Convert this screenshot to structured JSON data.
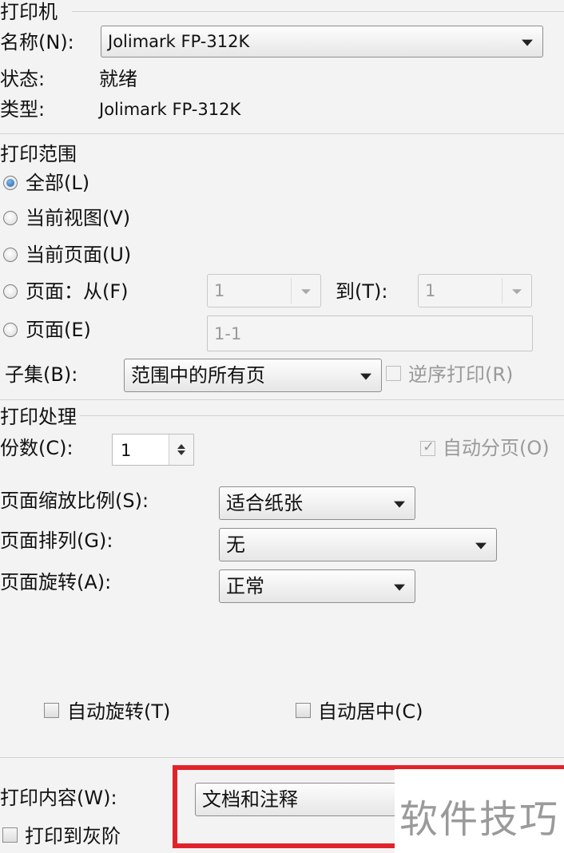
{
  "printer": {
    "group_title": "打印机",
    "name_label": "名称(N):",
    "name_value": "Jolimark FP-312K",
    "status_label": "状态:",
    "status_value": "就绪",
    "type_label": "类型:",
    "type_value": "Jolimark FP-312K"
  },
  "range": {
    "group_title": "打印范围",
    "all_label": "全部(L)",
    "current_view_label": "当前视图(V)",
    "current_page_label": "当前页面(U)",
    "pages_from_label": "页面：从(F)",
    "from_value": "1",
    "to_label": "到(T):",
    "to_value": "1",
    "pages_label": "页面(E)",
    "pages_value": "1-1",
    "subset_label": "子集(B):",
    "subset_value": "范围中的所有页",
    "reverse_label": "逆序打印(R)"
  },
  "handling": {
    "group_title": "打印处理",
    "copies_label": "份数(C):",
    "copies_value": "1",
    "collate_label": "自动分页(O)",
    "scale_label": "页面缩放比例(S):",
    "scale_value": "适合纸张",
    "arrange_label": "页面排列(G):",
    "arrange_value": "无",
    "rotate_label": "页面旋转(A):",
    "rotate_value": "正常",
    "auto_rotate_label": "自动旋转(T)",
    "auto_center_label": "自动居中(C)"
  },
  "content": {
    "label": "打印内容(W):",
    "value": "文档和注释",
    "grayscale_label": "打印到灰阶"
  },
  "watermark": "软件技巧",
  "colors": {
    "highlight": "#e0232b",
    "radio_selected": "#1f5fa8"
  }
}
